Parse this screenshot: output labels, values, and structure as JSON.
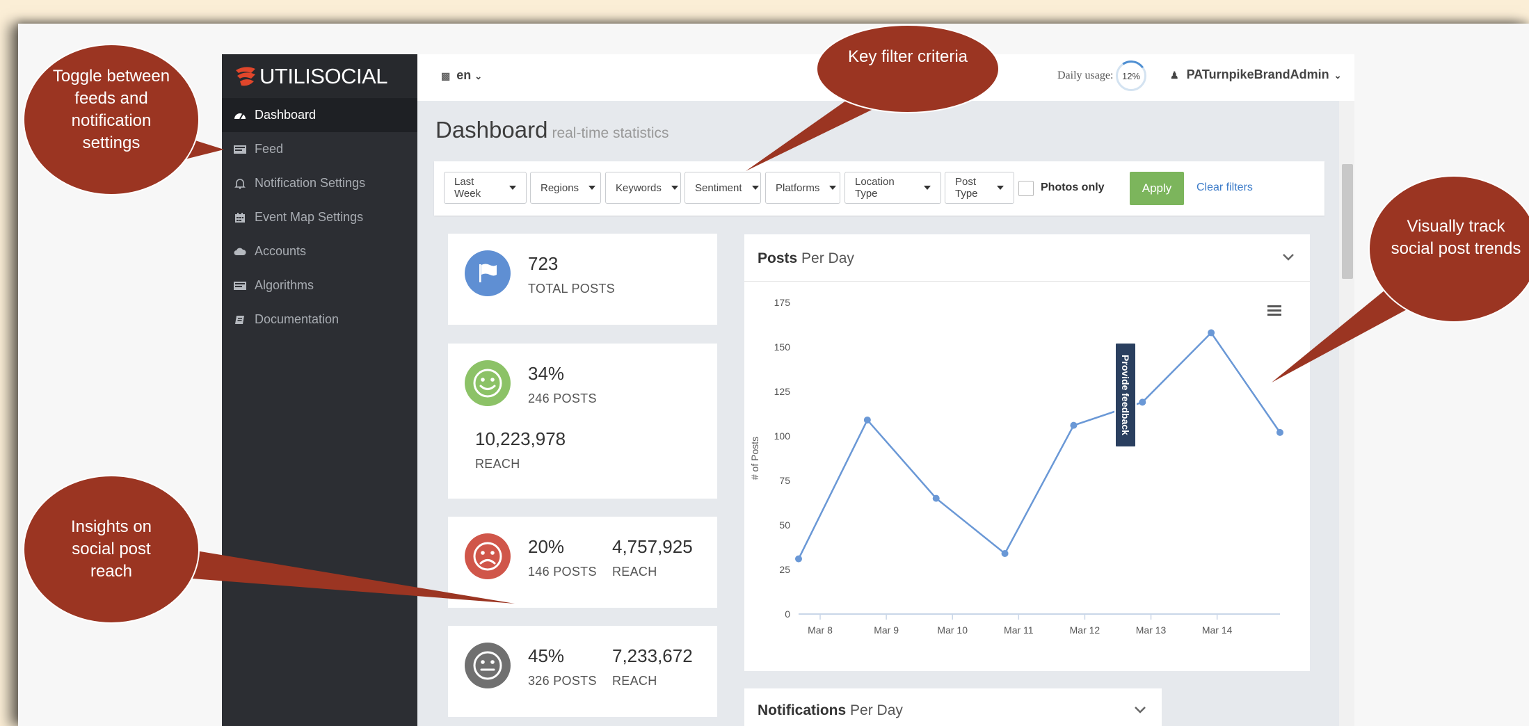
{
  "app": {
    "logo_text": "UTILISOCIAL",
    "language": "en",
    "daily_usage_label": "Daily usage:",
    "daily_usage_value": "12%",
    "user": "PATurnpikeBrandAdmin"
  },
  "sidebar": {
    "items": [
      {
        "label": "Dashboard",
        "icon": "dashboard-icon",
        "active": true
      },
      {
        "label": "Feed",
        "icon": "feed-icon"
      },
      {
        "label": "Notification Settings",
        "icon": "bell-icon"
      },
      {
        "label": "Event Map Settings",
        "icon": "calendar-icon"
      },
      {
        "label": "Accounts",
        "icon": "cloud-icon"
      },
      {
        "label": "Algorithms",
        "icon": "list-icon"
      },
      {
        "label": "Documentation",
        "icon": "book-icon"
      }
    ]
  },
  "page": {
    "title": "Dashboard",
    "subtitle": "real-time statistics"
  },
  "filters": {
    "dropdowns": [
      "Last Week",
      "Regions",
      "Keywords",
      "Sentiment",
      "Platforms",
      "Location Type",
      "Post Type"
    ],
    "photos_only": "Photos only",
    "apply": "Apply",
    "clear": "Clear filters"
  },
  "stats": {
    "total": {
      "value": "723",
      "label": "TOTAL POSTS"
    },
    "positive": {
      "percent": "34%",
      "posts": "246 POSTS",
      "reach": "10,223,978",
      "reach_label": "REACH"
    },
    "negative": {
      "percent": "20%",
      "posts": "146 POSTS",
      "reach": "4,757,925",
      "reach_label": "REACH"
    },
    "neutral": {
      "percent": "45%",
      "posts": "326 POSTS",
      "reach": "7,233,672",
      "reach_label": "REACH"
    }
  },
  "posts_panel": {
    "title_bold": "Posts",
    "title_rest": "Per Day"
  },
  "notifications_panel": {
    "title_bold": "Notifications",
    "title_rest": "Per Day"
  },
  "feedback_tab": "Provide feedback",
  "callouts": {
    "toggle": "Toggle between feeds and notification settings",
    "filter": "Key filter criteria",
    "trend": "Visually track social post trends",
    "reach": "Insights on social post reach"
  },
  "colors": {
    "callout": "#9b3522",
    "sidebar": "#2c2e33",
    "apply": "#7cb55c",
    "line": "#6a98d6",
    "positive": "#8cc267",
    "negative": "#d0564a",
    "neutral": "#707070",
    "total": "#5f8fd3"
  },
  "chart_data": {
    "type": "line",
    "categories": [
      "Mar 8",
      "Mar 9",
      "Mar 10",
      "Mar 11",
      "Mar 12",
      "Mar 13",
      "Mar 14"
    ],
    "x": [
      0,
      1,
      2,
      3,
      4,
      5,
      6,
      7
    ],
    "series": [
      {
        "values": [
          31,
          109,
          65,
          34,
          106,
          119,
          158,
          102
        ]
      }
    ],
    "ylabel": "# of Posts",
    "ylim": [
      0,
      175
    ],
    "yticks": [
      0,
      25,
      50,
      75,
      100,
      125,
      150,
      175
    ]
  }
}
